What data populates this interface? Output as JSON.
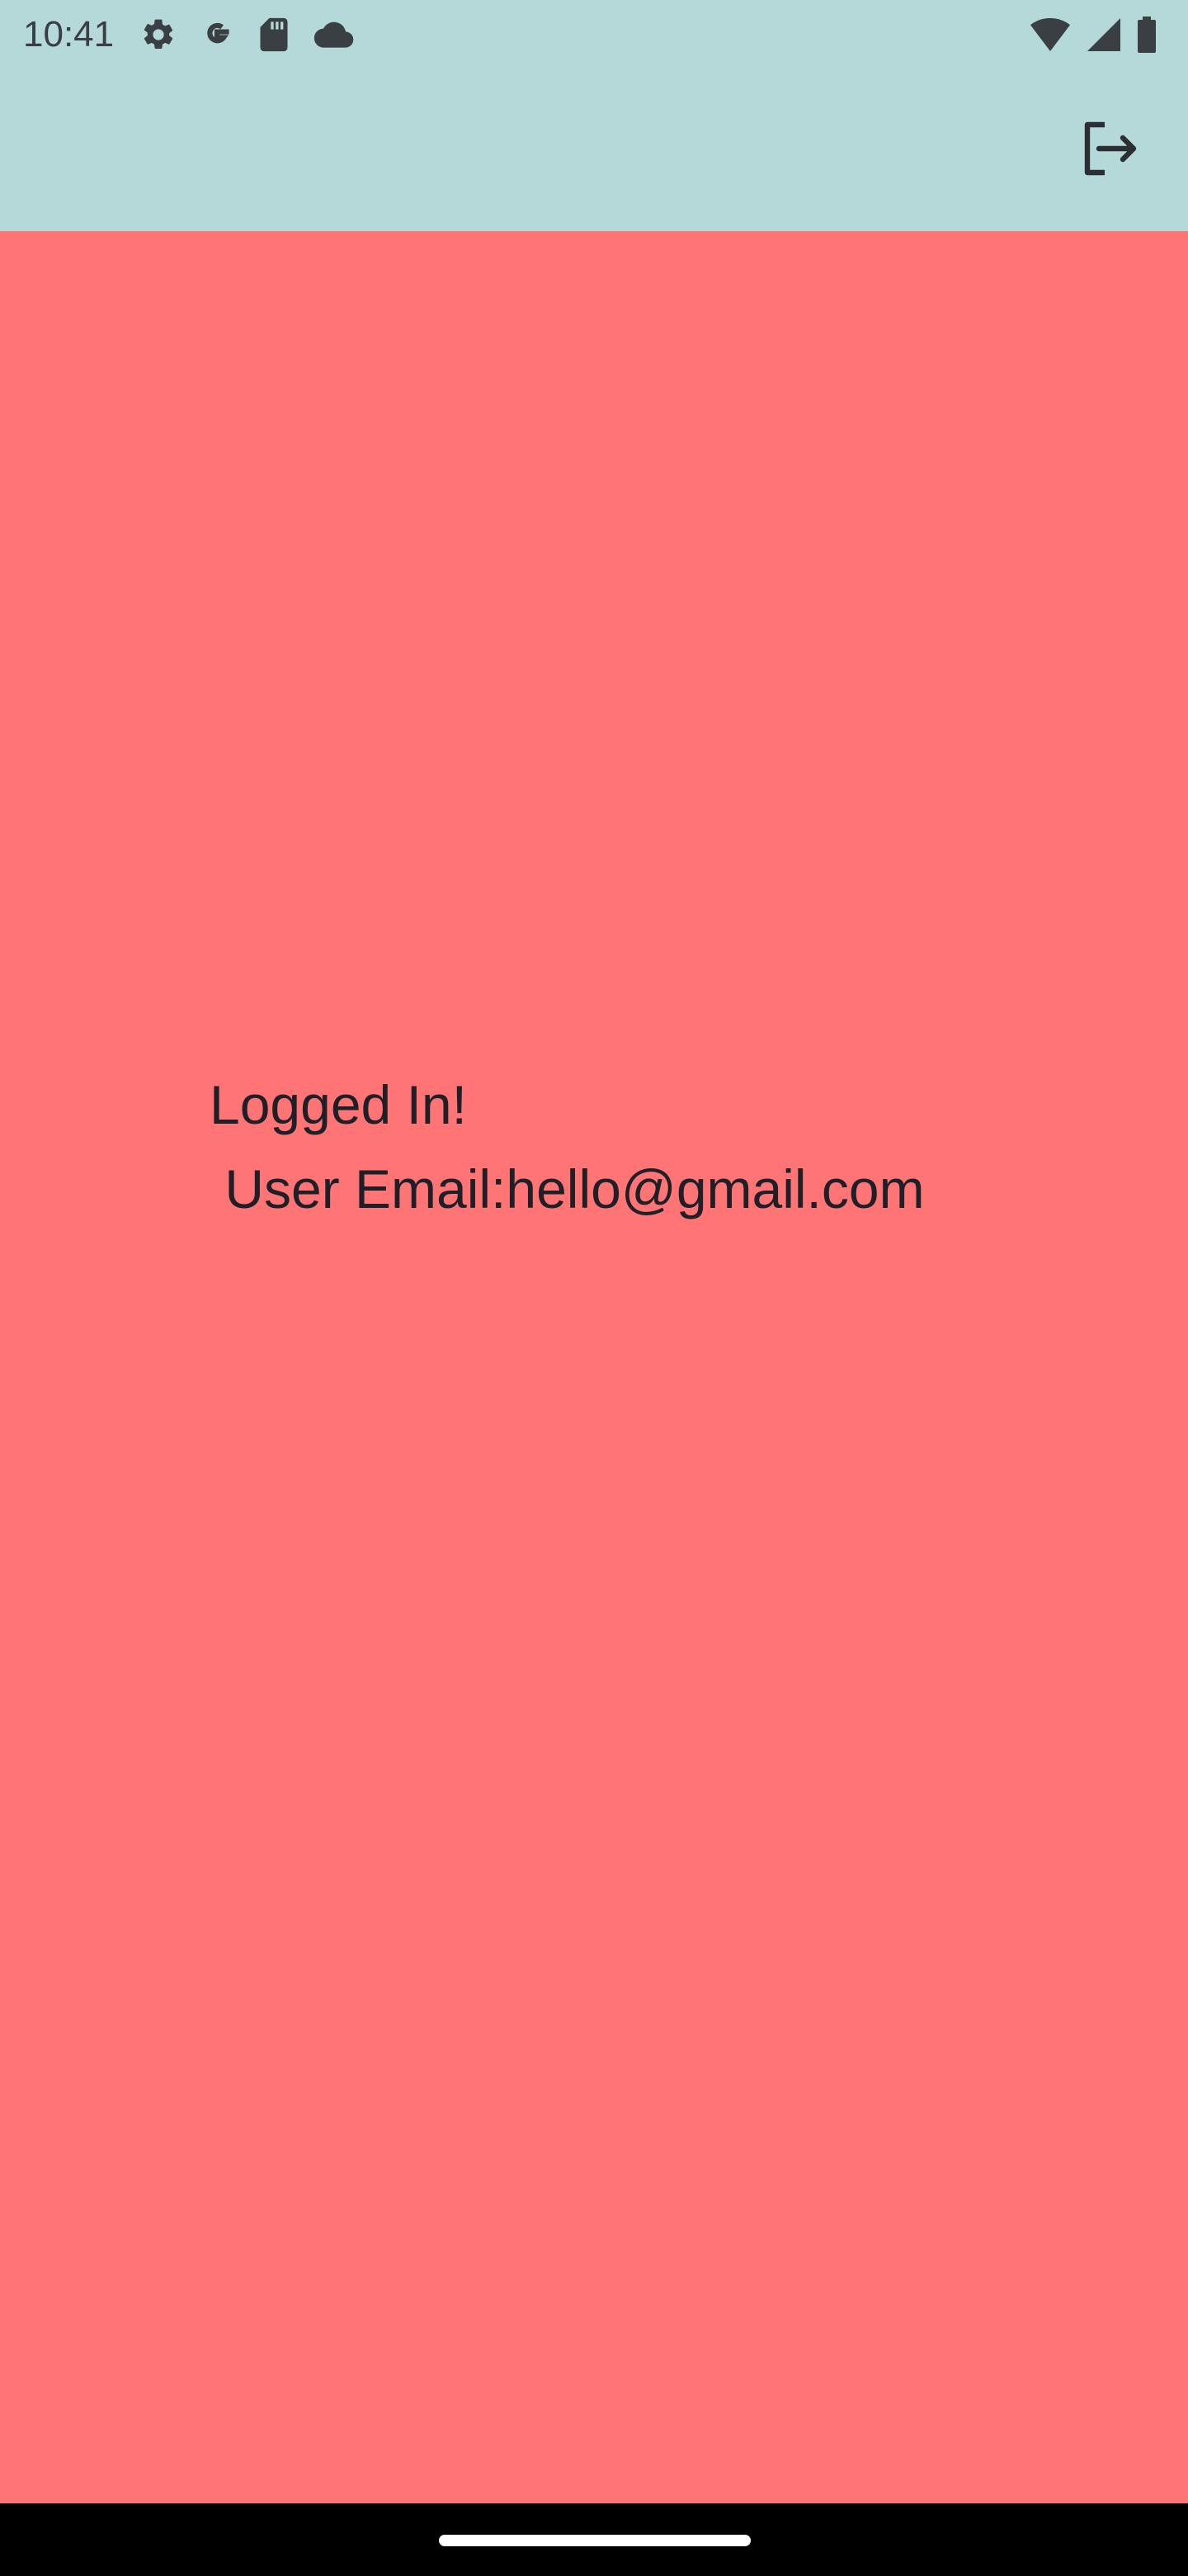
{
  "status_bar": {
    "time": "10:41",
    "left_icons": [
      "settings-icon",
      "google-icon",
      "sd-card-icon",
      "cloud-icon"
    ],
    "right_icons": [
      "wifi-icon",
      "cellular-signal-icon",
      "battery-icon"
    ]
  },
  "app_bar": {
    "background_color": "#b5d9d9",
    "logout_icon": "logout-icon"
  },
  "main": {
    "background_color": "#ff7474",
    "message_line_1": "Logged In!",
    "message_line_2": " User Email:hello@gmail.com"
  },
  "navigation_bar": {
    "background_color": "#000000"
  }
}
